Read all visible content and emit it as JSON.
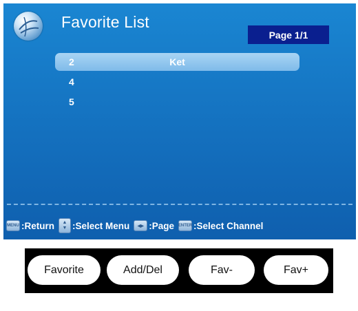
{
  "osd": {
    "title": "Favorite List",
    "page_label": "Page 1/1",
    "channels": [
      {
        "number": "2",
        "name": "Ket",
        "selected": true
      },
      {
        "number": "4",
        "name": "",
        "selected": false
      },
      {
        "number": "5",
        "name": "",
        "selected": false
      }
    ],
    "help": {
      "menu_key": "MENU",
      "return_label": ":Return",
      "select_menu_label": ":Select Menu",
      "page_label": ":Page",
      "enter_key": "ENTER",
      "select_channel_label": ":Select Channel"
    }
  },
  "remote": {
    "buttons": [
      "Favorite",
      "Add/Del",
      "Fav-",
      "Fav+"
    ]
  },
  "colors": {
    "osd_background": "#1574c2",
    "selection_highlight": "#a9d4f4",
    "page_badge": "#0a1f8f",
    "remote_background": "#000000"
  }
}
